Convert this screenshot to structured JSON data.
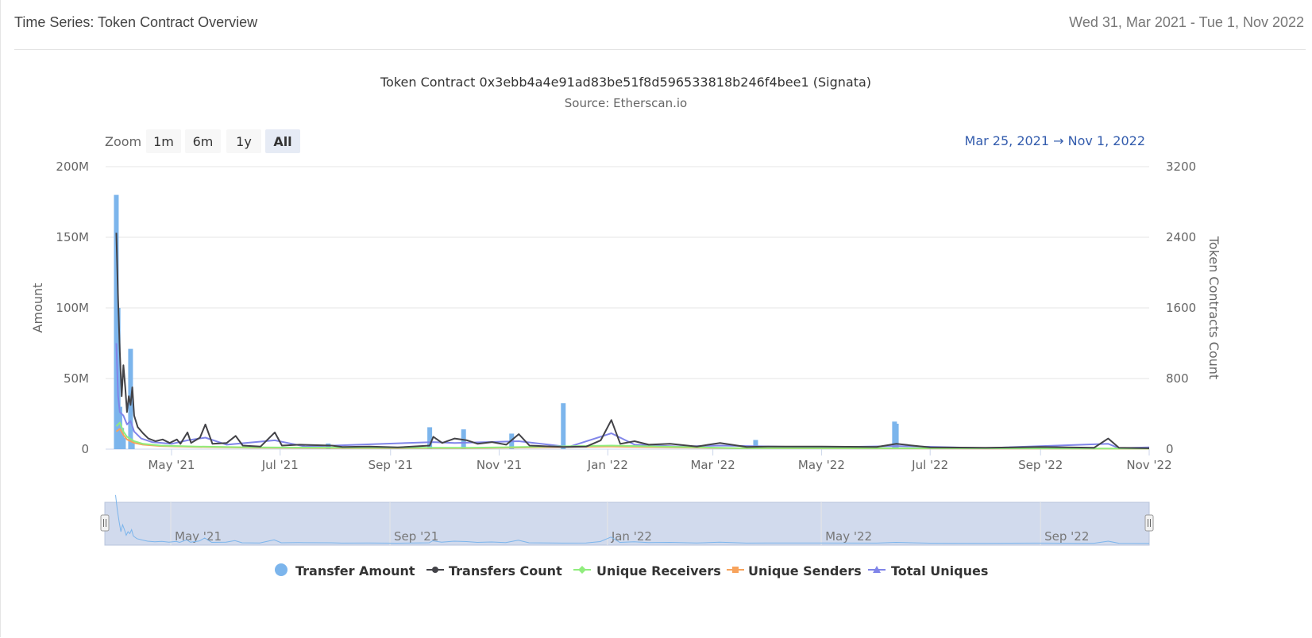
{
  "header": {
    "title": "Time Series: Token Contract Overview",
    "range": "Wed 31, Mar 2021 - Tue 1, Nov 2022"
  },
  "chart_data": {
    "type": "bar",
    "title": "Token Contract 0x3ebb4a4e91ad83be51f8d596533818b246f4bee1 (Signata)",
    "subtitle": "Source: Etherscan.io",
    "zoom": {
      "label": "Zoom",
      "buttons": [
        "1m",
        "6m",
        "1y",
        "All"
      ],
      "active": "All"
    },
    "range_display": {
      "from": "Mar 25, 2021",
      "arrow": "→",
      "to": "Nov 1, 2022"
    },
    "ylabel": "Amount",
    "y2label": "Token Contracts Count",
    "ylim": [
      0,
      200000000
    ],
    "y2lim": [
      0,
      3200
    ],
    "yticks": [
      {
        "v": 0,
        "t": "0"
      },
      {
        "v": 50000000,
        "t": "50M"
      },
      {
        "v": 100000000,
        "t": "100M"
      },
      {
        "v": 150000000,
        "t": "150M"
      },
      {
        "v": 200000000,
        "t": "200M"
      }
    ],
    "y2ticks": [
      {
        "v": 0,
        "t": "0"
      },
      {
        "v": 800,
        "t": "800"
      },
      {
        "v": 1600,
        "t": "1600"
      },
      {
        "v": 2400,
        "t": "2400"
      },
      {
        "v": 3200,
        "t": "3200"
      }
    ],
    "xlim": [
      "2021-03-25",
      "2022-11-01"
    ],
    "xticks": [
      {
        "d": "2021-05-01",
        "t": "May '21"
      },
      {
        "d": "2021-07-01",
        "t": "Jul '21"
      },
      {
        "d": "2021-09-01",
        "t": "Sep '21"
      },
      {
        "d": "2021-11-01",
        "t": "Nov '21"
      },
      {
        "d": "2022-01-01",
        "t": "Jan '22"
      },
      {
        "d": "2022-03-01",
        "t": "Mar '22"
      },
      {
        "d": "2022-05-01",
        "t": "May '22"
      },
      {
        "d": "2022-07-01",
        "t": "Jul '22"
      },
      {
        "d": "2022-09-01",
        "t": "Sep '22"
      },
      {
        "d": "2022-11-01",
        "t": "Nov '22"
      }
    ],
    "navigator_ticks": [
      {
        "d": "2021-05-01",
        "t": "May '21"
      },
      {
        "d": "2021-09-01",
        "t": "Sep '21"
      },
      {
        "d": "2022-01-01",
        "t": "Jan '22"
      },
      {
        "d": "2022-05-01",
        "t": "May '22"
      },
      {
        "d": "2022-09-01",
        "t": "Sep '22"
      }
    ],
    "grid": true,
    "legend_position": "bottom-center",
    "colors": {
      "transfer_amount": "#7cb5ec",
      "transfers_count": "#434348",
      "unique_receivers": "#90ed7d",
      "unique_senders": "#f7a35c",
      "total_uniques": "#8085e9"
    },
    "series": [
      {
        "name": "Transfer Amount",
        "axis": "left",
        "kind": "bar",
        "color_key": "transfer_amount",
        "points": [
          {
            "date": "2021-03-31",
            "value": 180000000
          },
          {
            "date": "2021-04-01",
            "value": 100000000
          },
          {
            "date": "2021-04-02",
            "value": 30000000
          },
          {
            "date": "2021-04-03",
            "value": 15000000
          },
          {
            "date": "2021-04-04",
            "value": 8000000
          },
          {
            "date": "2021-04-08",
            "value": 71000000
          },
          {
            "date": "2021-04-09",
            "value": 6000000
          },
          {
            "date": "2021-07-28",
            "value": 4000000
          },
          {
            "date": "2021-09-23",
            "value": 15500000
          },
          {
            "date": "2021-10-12",
            "value": 14000000
          },
          {
            "date": "2021-11-08",
            "value": 11000000
          },
          {
            "date": "2021-12-07",
            "value": 32500000
          },
          {
            "date": "2022-03-25",
            "value": 6500000
          },
          {
            "date": "2022-06-11",
            "value": 19500000
          },
          {
            "date": "2022-06-12",
            "value": 18000000
          }
        ]
      },
      {
        "name": "Transfers Count",
        "axis": "right",
        "kind": "line",
        "color_key": "transfers_count",
        "marker": "circle",
        "points": [
          {
            "date": "2021-03-31",
            "value": 2450
          },
          {
            "date": "2021-04-01",
            "value": 1700
          },
          {
            "date": "2021-04-02",
            "value": 1100
          },
          {
            "date": "2021-04-03",
            "value": 600
          },
          {
            "date": "2021-04-04",
            "value": 950
          },
          {
            "date": "2021-04-05",
            "value": 700
          },
          {
            "date": "2021-04-06",
            "value": 420
          },
          {
            "date": "2021-04-07",
            "value": 600
          },
          {
            "date": "2021-04-08",
            "value": 500
          },
          {
            "date": "2021-04-09",
            "value": 700
          },
          {
            "date": "2021-04-10",
            "value": 380
          },
          {
            "date": "2021-04-12",
            "value": 250
          },
          {
            "date": "2021-04-15",
            "value": 180
          },
          {
            "date": "2021-04-18",
            "value": 120
          },
          {
            "date": "2021-04-22",
            "value": 90
          },
          {
            "date": "2021-04-26",
            "value": 110
          },
          {
            "date": "2021-04-30",
            "value": 70
          },
          {
            "date": "2021-05-04",
            "value": 110
          },
          {
            "date": "2021-05-06",
            "value": 60
          },
          {
            "date": "2021-05-10",
            "value": 190
          },
          {
            "date": "2021-05-12",
            "value": 70
          },
          {
            "date": "2021-05-17",
            "value": 130
          },
          {
            "date": "2021-05-20",
            "value": 280
          },
          {
            "date": "2021-05-24",
            "value": 60
          },
          {
            "date": "2021-06-01",
            "value": 70
          },
          {
            "date": "2021-06-06",
            "value": 150
          },
          {
            "date": "2021-06-10",
            "value": 40
          },
          {
            "date": "2021-06-20",
            "value": 30
          },
          {
            "date": "2021-06-28",
            "value": 190
          },
          {
            "date": "2021-07-02",
            "value": 40
          },
          {
            "date": "2021-07-12",
            "value": 50
          },
          {
            "date": "2021-07-30",
            "value": 40
          },
          {
            "date": "2021-08-05",
            "value": 25
          },
          {
            "date": "2021-08-20",
            "value": 30
          },
          {
            "date": "2021-09-05",
            "value": 20
          },
          {
            "date": "2021-09-23",
            "value": 40
          },
          {
            "date": "2021-09-25",
            "value": 140
          },
          {
            "date": "2021-09-30",
            "value": 70
          },
          {
            "date": "2021-10-07",
            "value": 120
          },
          {
            "date": "2021-10-14",
            "value": 100
          },
          {
            "date": "2021-10-20",
            "value": 60
          },
          {
            "date": "2021-10-28",
            "value": 80
          },
          {
            "date": "2021-11-05",
            "value": 50
          },
          {
            "date": "2021-11-12",
            "value": 170
          },
          {
            "date": "2021-11-18",
            "value": 40
          },
          {
            "date": "2021-12-01",
            "value": 30
          },
          {
            "date": "2021-12-07",
            "value": 25
          },
          {
            "date": "2021-12-20",
            "value": 30
          },
          {
            "date": "2021-12-28",
            "value": 100
          },
          {
            "date": "2022-01-03",
            "value": 330
          },
          {
            "date": "2022-01-08",
            "value": 60
          },
          {
            "date": "2022-01-16",
            "value": 90
          },
          {
            "date": "2022-01-24",
            "value": 50
          },
          {
            "date": "2022-02-05",
            "value": 60
          },
          {
            "date": "2022-02-20",
            "value": 30
          },
          {
            "date": "2022-03-05",
            "value": 70
          },
          {
            "date": "2022-03-20",
            "value": 25
          },
          {
            "date": "2022-04-01",
            "value": 30
          },
          {
            "date": "2022-05-01",
            "value": 30
          },
          {
            "date": "2022-06-01",
            "value": 25
          },
          {
            "date": "2022-06-12",
            "value": 60
          },
          {
            "date": "2022-07-01",
            "value": 20
          },
          {
            "date": "2022-08-01",
            "value": 15
          },
          {
            "date": "2022-09-01",
            "value": 25
          },
          {
            "date": "2022-10-01",
            "value": 15
          },
          {
            "date": "2022-10-09",
            "value": 120
          },
          {
            "date": "2022-10-15",
            "value": 15
          },
          {
            "date": "2022-11-01",
            "value": 10
          }
        ]
      },
      {
        "name": "Unique Receivers",
        "axis": "right",
        "kind": "line",
        "color_key": "unique_receivers",
        "marker": "diamond",
        "points": [
          {
            "date": "2021-03-31",
            "value": 260
          },
          {
            "date": "2021-04-02",
            "value": 300
          },
          {
            "date": "2021-04-04",
            "value": 200
          },
          {
            "date": "2021-04-06",
            "value": 140
          },
          {
            "date": "2021-04-10",
            "value": 90
          },
          {
            "date": "2021-04-15",
            "value": 60
          },
          {
            "date": "2021-04-25",
            "value": 40
          },
          {
            "date": "2021-05-15",
            "value": 30
          },
          {
            "date": "2021-06-15",
            "value": 20
          },
          {
            "date": "2021-08-15",
            "value": 15
          },
          {
            "date": "2021-10-15",
            "value": 15
          },
          {
            "date": "2022-01-03",
            "value": 40
          },
          {
            "date": "2022-03-15",
            "value": 12
          },
          {
            "date": "2022-06-15",
            "value": 10
          },
          {
            "date": "2022-09-15",
            "value": 8
          },
          {
            "date": "2022-11-01",
            "value": 6
          }
        ]
      },
      {
        "name": "Unique Senders",
        "axis": "right",
        "kind": "line",
        "color_key": "unique_senders",
        "marker": "square",
        "points": [
          {
            "date": "2021-03-31",
            "value": 200
          },
          {
            "date": "2021-04-02",
            "value": 230
          },
          {
            "date": "2021-04-04",
            "value": 160
          },
          {
            "date": "2021-04-06",
            "value": 110
          },
          {
            "date": "2021-04-10",
            "value": 70
          },
          {
            "date": "2021-04-15",
            "value": 50
          },
          {
            "date": "2021-04-25",
            "value": 35
          },
          {
            "date": "2021-05-15",
            "value": 25
          },
          {
            "date": "2021-06-15",
            "value": 15
          },
          {
            "date": "2021-08-15",
            "value": 12
          },
          {
            "date": "2021-10-15",
            "value": 12
          },
          {
            "date": "2022-01-03",
            "value": 30
          },
          {
            "date": "2022-03-15",
            "value": 10
          },
          {
            "date": "2022-06-15",
            "value": 8
          },
          {
            "date": "2022-09-15",
            "value": 6
          },
          {
            "date": "2022-11-01",
            "value": 5
          }
        ]
      },
      {
        "name": "Total Uniques",
        "axis": "right",
        "kind": "line",
        "color_key": "total_uniques",
        "marker": "triangle",
        "points": [
          {
            "date": "2021-03-31",
            "value": 1200
          },
          {
            "date": "2021-04-01",
            "value": 600
          },
          {
            "date": "2021-04-02",
            "value": 420
          },
          {
            "date": "2021-04-04",
            "value": 380
          },
          {
            "date": "2021-04-06",
            "value": 280
          },
          {
            "date": "2021-04-08",
            "value": 320
          },
          {
            "date": "2021-04-10",
            "value": 200
          },
          {
            "date": "2021-04-14",
            "value": 120
          },
          {
            "date": "2021-04-20",
            "value": 80
          },
          {
            "date": "2021-05-01",
            "value": 60
          },
          {
            "date": "2021-05-10",
            "value": 100
          },
          {
            "date": "2021-05-20",
            "value": 130
          },
          {
            "date": "2021-06-01",
            "value": 50
          },
          {
            "date": "2021-06-28",
            "value": 100
          },
          {
            "date": "2021-07-15",
            "value": 30
          },
          {
            "date": "2021-09-25",
            "value": 80
          },
          {
            "date": "2021-10-07",
            "value": 70
          },
          {
            "date": "2021-11-12",
            "value": 90
          },
          {
            "date": "2021-12-10",
            "value": 25
          },
          {
            "date": "2022-01-03",
            "value": 180
          },
          {
            "date": "2022-01-16",
            "value": 50
          },
          {
            "date": "2022-02-10",
            "value": 30
          },
          {
            "date": "2022-03-05",
            "value": 40
          },
          {
            "date": "2022-05-01",
            "value": 20
          },
          {
            "date": "2022-06-12",
            "value": 35
          },
          {
            "date": "2022-08-01",
            "value": 12
          },
          {
            "date": "2022-10-09",
            "value": 60
          },
          {
            "date": "2022-10-15",
            "value": 12
          },
          {
            "date": "2022-11-01",
            "value": 20
          }
        ]
      }
    ]
  }
}
